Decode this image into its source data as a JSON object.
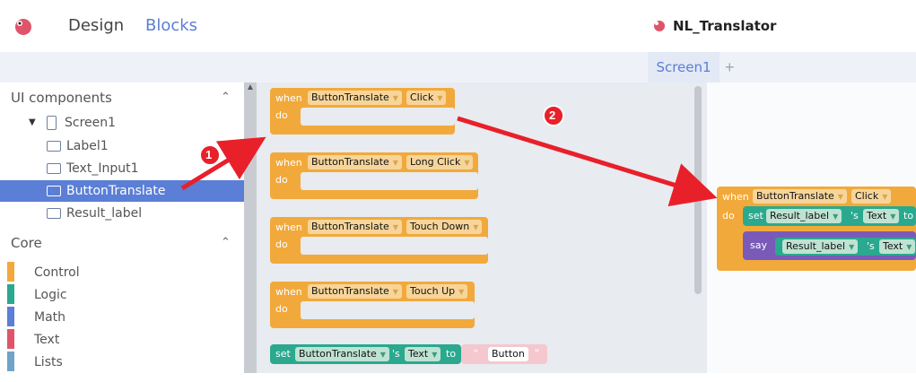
{
  "header": {
    "tabs": [
      "Design",
      "Blocks"
    ],
    "project_name": "NL_Translator"
  },
  "screen_tabs": {
    "active": "Screen1",
    "add_label": "+"
  },
  "sidebar": {
    "ui_components_title": "UI components",
    "screen_label": "Screen1",
    "components": [
      "Label1",
      "Text_Input1",
      "ButtonTranslate",
      "Result_label"
    ],
    "core_title": "Core",
    "core_items": [
      {
        "label": "Control",
        "color": "#f2a93b"
      },
      {
        "label": "Logic",
        "color": "#2aa98f"
      },
      {
        "label": "Math",
        "color": "#5b7ed6"
      },
      {
        "label": "Text",
        "color": "#e0546a"
      },
      {
        "label": "Lists",
        "color": "#6fa3c8"
      }
    ]
  },
  "flyout_blocks": {
    "when": "when",
    "do": "do",
    "component": "ButtonTranslate",
    "events": [
      "Click",
      "Long Click",
      "Touch Down",
      "Touch Up"
    ],
    "set": "set",
    "s": "'s",
    "prop": "Text",
    "to": "to",
    "string": "Button"
  },
  "workspace_block": {
    "when": "when",
    "component": "ButtonTranslate",
    "event": "Click",
    "do": "do",
    "set": "set",
    "target": "Result_label",
    "s": "'s",
    "prop": "Text",
    "to": "to",
    "say": "say"
  },
  "annotations": [
    "1",
    "2"
  ]
}
